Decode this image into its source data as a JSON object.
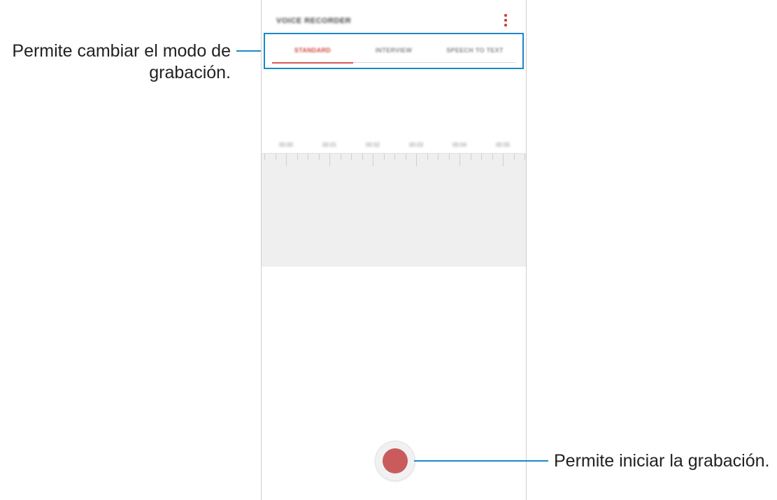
{
  "app": {
    "title": "VOICE RECORDER",
    "more_icon": "more-vertical-icon",
    "accent_color": "#c9413f"
  },
  "tabs": [
    {
      "label": "STANDARD",
      "active": true
    },
    {
      "label": "INTERVIEW",
      "active": false
    },
    {
      "label": "SPEECH TO TEXT",
      "active": false
    }
  ],
  "timeline": {
    "labels": [
      "00:00",
      "00:01",
      "00:02",
      "00:03",
      "00:04",
      "00:05"
    ]
  },
  "record_button": {
    "icon": "record-icon",
    "color": "#c95b5c"
  },
  "annotations": {
    "mode_line1": "Permite cambiar el modo de",
    "mode_line2": "grabación.",
    "record": "Permite iniciar la grabación.",
    "line_color": "#1a88c9"
  }
}
